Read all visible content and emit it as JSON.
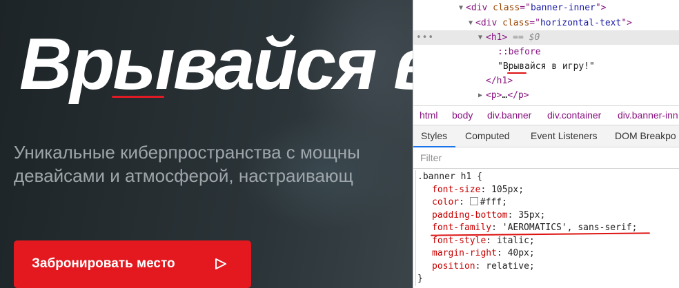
{
  "page": {
    "heading": "Врывайся в",
    "description": "Уникальные киберпространства с мощны\nдевайсами и атмосферой, настраивающ",
    "book_button": "Забронировать место",
    "accent_color": "#e3191f"
  },
  "devtools": {
    "dom": {
      "line1": {
        "tag_open": "<div ",
        "attr": "class",
        "eq": "=\"",
        "value": "banner-inner",
        "close": "\">"
      },
      "line2": {
        "tag_open": "<div ",
        "attr": "class",
        "eq": "=\"",
        "value": "horizontal-text",
        "close": "\">"
      },
      "line3": {
        "tag": "<h1>",
        "marker": "== $0",
        "dots": "•••"
      },
      "line4": {
        "pseudo": "::before"
      },
      "line5": {
        "text": "\"Врывайся в игру!\""
      },
      "line6": {
        "tag": "</h1>"
      },
      "line7": {
        "tag_open": "<p>",
        "ellipsis": "…",
        "tag_close": "</p>"
      }
    },
    "breadcrumbs": [
      "html",
      "body",
      "div.banner",
      "div.container",
      "div.banner-inn"
    ],
    "tabs": [
      "Styles",
      "Computed",
      "Event Listeners",
      "DOM Breakpo"
    ],
    "active_tab": "Styles",
    "filter_placeholder": "Filter",
    "rule": {
      "selector": ".banner h1 {",
      "declarations": [
        {
          "prop": "font-size",
          "value": "105px;"
        },
        {
          "prop": "color",
          "value": "#fff;"
        },
        {
          "prop": "padding-bottom",
          "value": "35px;"
        },
        {
          "prop": "font-family",
          "value": "'AEROMATICS', sans-serif;"
        },
        {
          "prop": "font-style",
          "value": "italic;"
        },
        {
          "prop": "margin-right",
          "value": "40px;"
        },
        {
          "prop": "position",
          "value": "relative;"
        }
      ],
      "close": "}"
    }
  }
}
